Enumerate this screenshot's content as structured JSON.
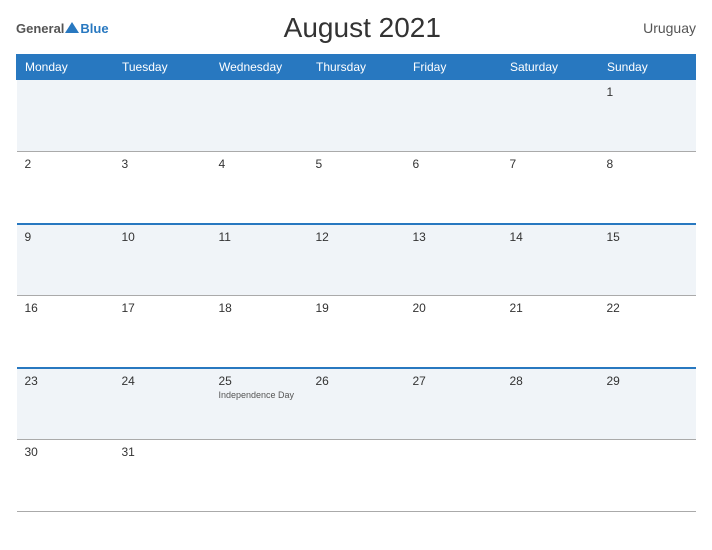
{
  "header": {
    "logo_general": "General",
    "logo_blue": "Blue",
    "title": "August 2021",
    "country": "Uruguay"
  },
  "weekdays": [
    "Monday",
    "Tuesday",
    "Wednesday",
    "Thursday",
    "Friday",
    "Saturday",
    "Sunday"
  ],
  "weeks": [
    [
      {
        "day": "",
        "holiday": ""
      },
      {
        "day": "",
        "holiday": ""
      },
      {
        "day": "",
        "holiday": ""
      },
      {
        "day": "",
        "holiday": ""
      },
      {
        "day": "",
        "holiday": ""
      },
      {
        "day": "",
        "holiday": ""
      },
      {
        "day": "1",
        "holiday": ""
      }
    ],
    [
      {
        "day": "2",
        "holiday": ""
      },
      {
        "day": "3",
        "holiday": ""
      },
      {
        "day": "4",
        "holiday": ""
      },
      {
        "day": "5",
        "holiday": ""
      },
      {
        "day": "6",
        "holiday": ""
      },
      {
        "day": "7",
        "holiday": ""
      },
      {
        "day": "8",
        "holiday": ""
      }
    ],
    [
      {
        "day": "9",
        "holiday": ""
      },
      {
        "day": "10",
        "holiday": ""
      },
      {
        "day": "11",
        "holiday": ""
      },
      {
        "day": "12",
        "holiday": ""
      },
      {
        "day": "13",
        "holiday": ""
      },
      {
        "day": "14",
        "holiday": ""
      },
      {
        "day": "15",
        "holiday": ""
      }
    ],
    [
      {
        "day": "16",
        "holiday": ""
      },
      {
        "day": "17",
        "holiday": ""
      },
      {
        "day": "18",
        "holiday": ""
      },
      {
        "day": "19",
        "holiday": ""
      },
      {
        "day": "20",
        "holiday": ""
      },
      {
        "day": "21",
        "holiday": ""
      },
      {
        "day": "22",
        "holiday": ""
      }
    ],
    [
      {
        "day": "23",
        "holiday": ""
      },
      {
        "day": "24",
        "holiday": ""
      },
      {
        "day": "25",
        "holiday": "Independence Day"
      },
      {
        "day": "26",
        "holiday": ""
      },
      {
        "day": "27",
        "holiday": ""
      },
      {
        "day": "28",
        "holiday": ""
      },
      {
        "day": "29",
        "holiday": ""
      }
    ],
    [
      {
        "day": "30",
        "holiday": ""
      },
      {
        "day": "31",
        "holiday": ""
      },
      {
        "day": "",
        "holiday": ""
      },
      {
        "day": "",
        "holiday": ""
      },
      {
        "day": "",
        "holiday": ""
      },
      {
        "day": "",
        "holiday": ""
      },
      {
        "day": "",
        "holiday": ""
      }
    ]
  ],
  "blue_top_rows": [
    2,
    4
  ]
}
